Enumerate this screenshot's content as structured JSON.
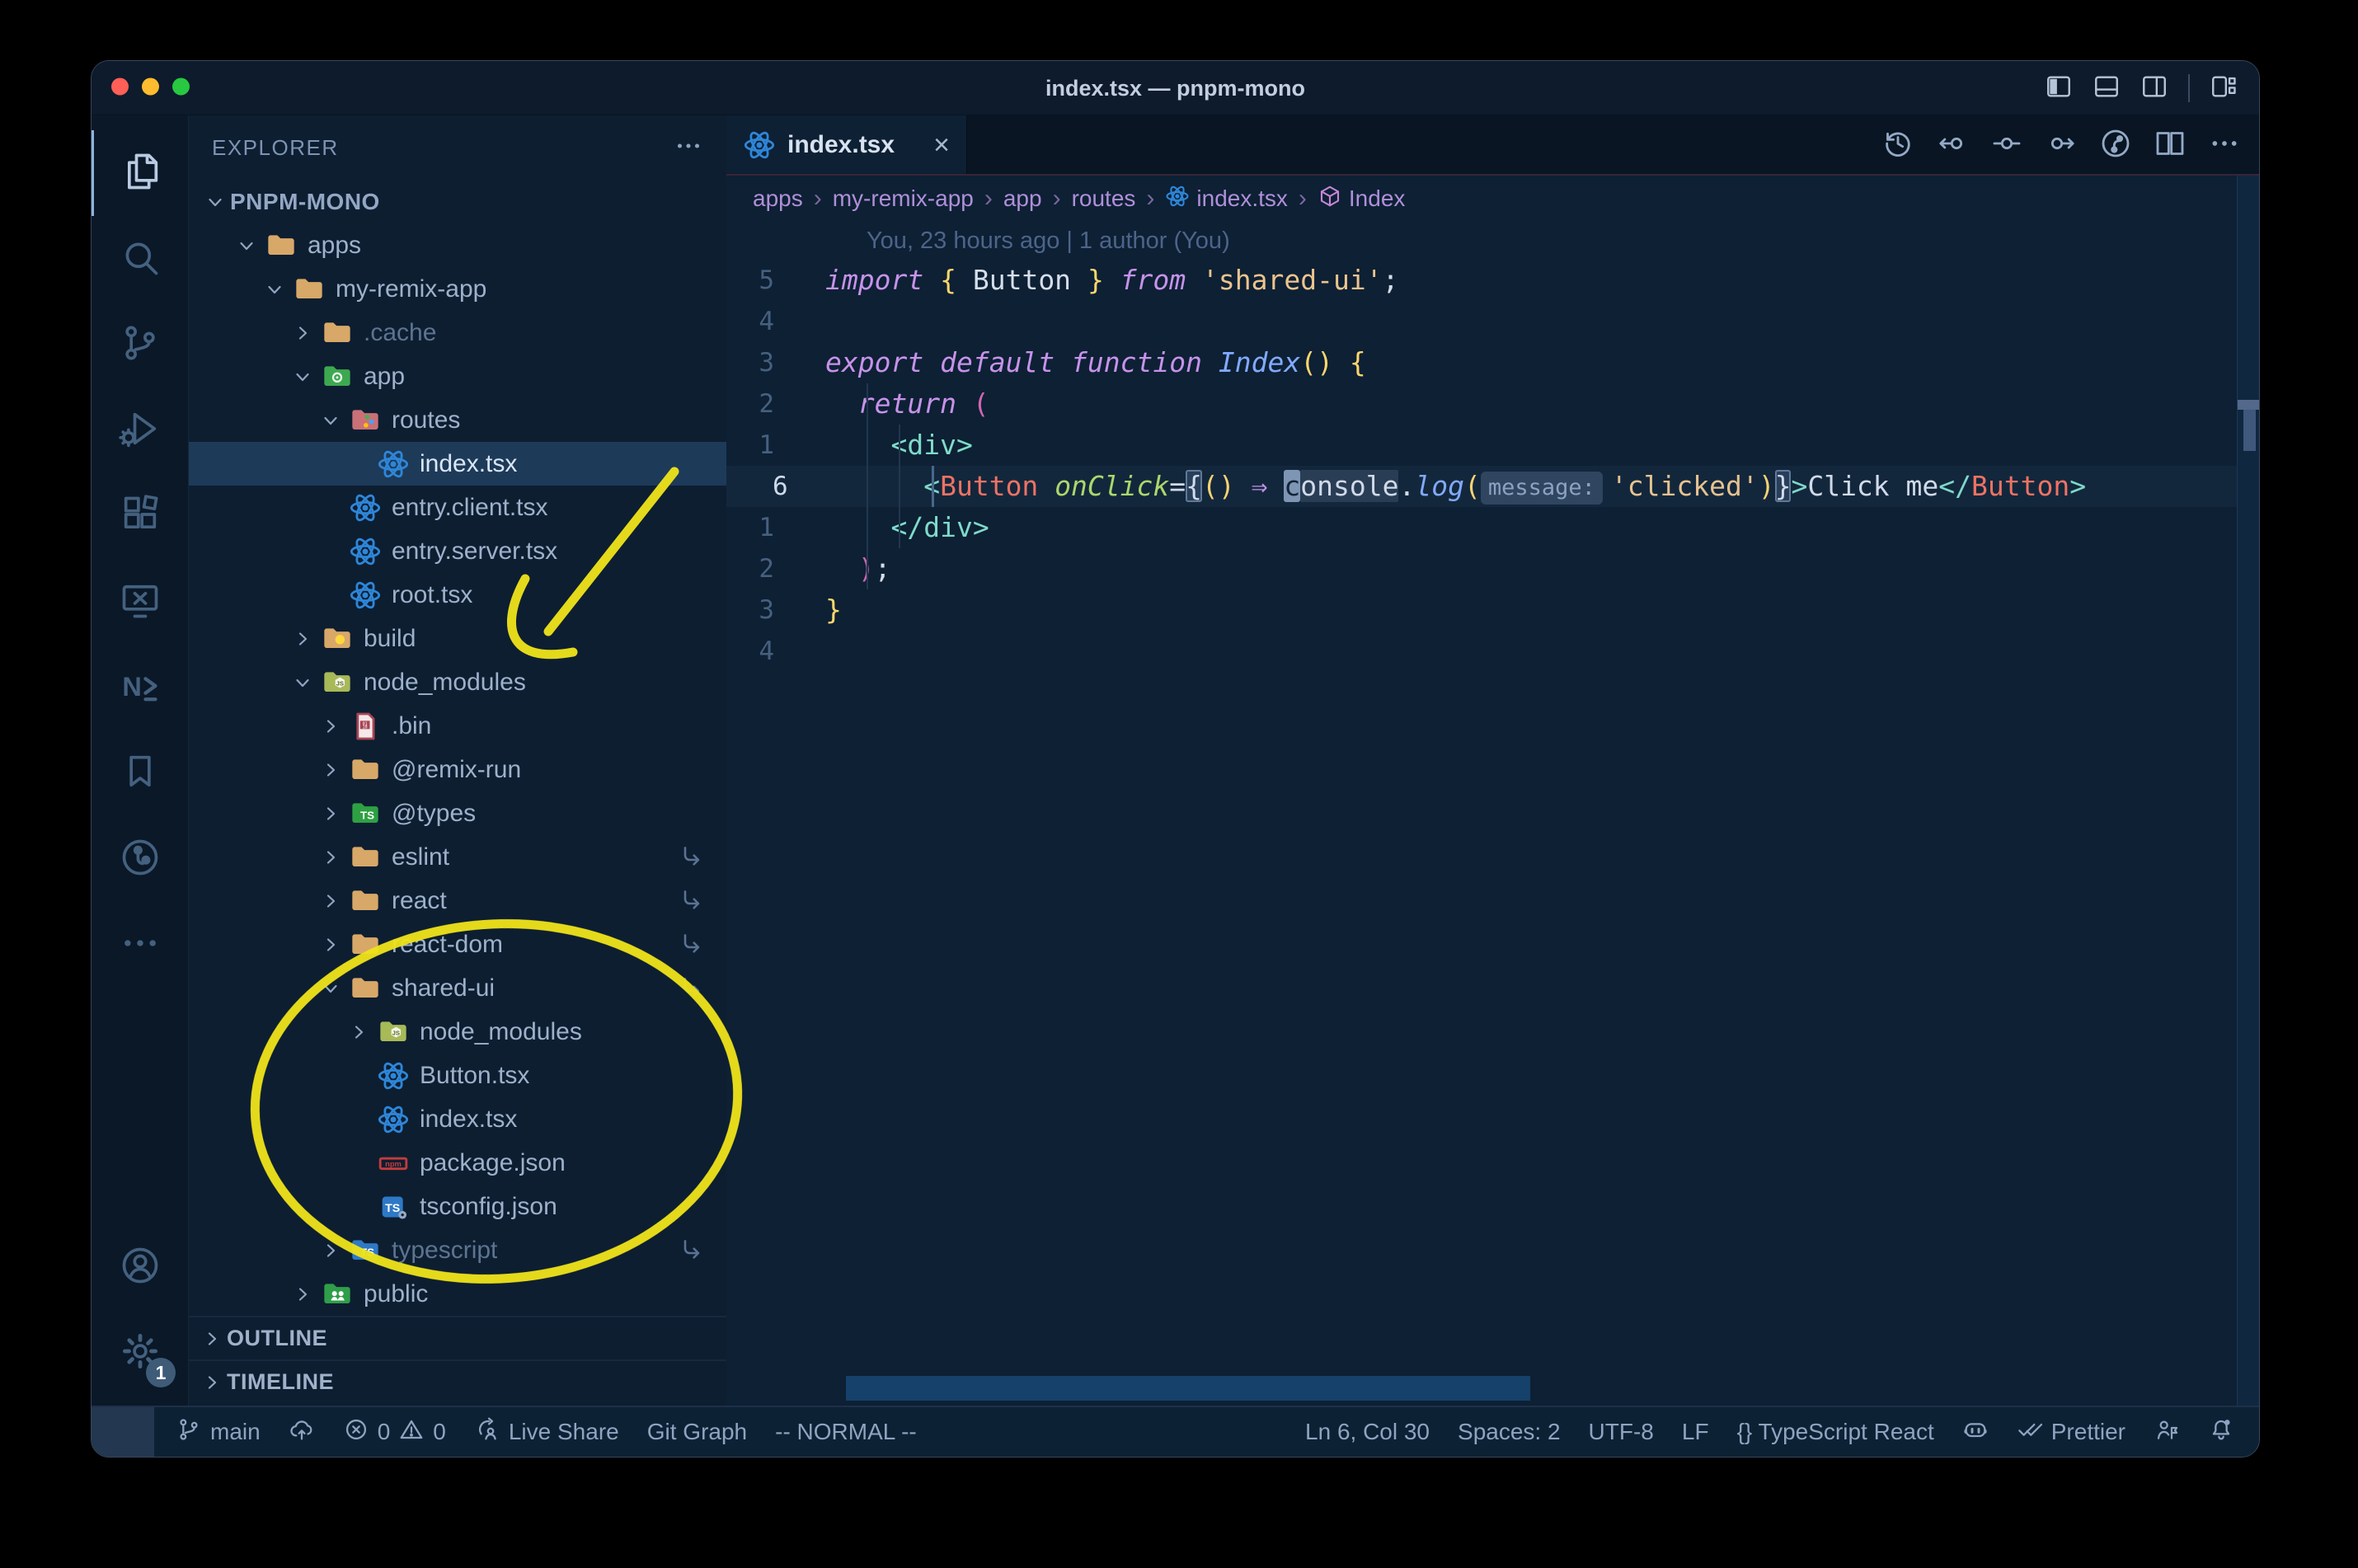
{
  "window": {
    "title": "index.tsx — pnpm-mono"
  },
  "titlebar": {
    "traffic_lights": [
      "close",
      "minimize",
      "zoom"
    ],
    "traffic_colors": [
      "#ff5f57",
      "#febc2e",
      "#28c840"
    ],
    "controls": [
      {
        "name": "toggle-primary-sidebar",
        "icon": "layout-left"
      },
      {
        "name": "toggle-panel",
        "icon": "layout-bottom"
      },
      {
        "name": "toggle-secondary-sidebar",
        "icon": "layout-right"
      },
      {
        "name": "separator",
        "icon": "separator"
      },
      {
        "name": "customize-layout",
        "icon": "layout-custom"
      }
    ]
  },
  "activity_bar": {
    "top": [
      {
        "name": "explorer",
        "icon": "files",
        "active": true
      },
      {
        "name": "search",
        "icon": "search"
      },
      {
        "name": "source-control",
        "icon": "scm"
      },
      {
        "name": "run-and-debug",
        "icon": "debug"
      },
      {
        "name": "extensions",
        "icon": "extensions"
      },
      {
        "name": "remote-explorer",
        "icon": "remote"
      },
      {
        "name": "nx-console",
        "icon": "nx"
      },
      {
        "name": "bookmarks",
        "icon": "bookmark"
      },
      {
        "name": "gitlens",
        "icon": "gitlens"
      },
      {
        "name": "additional-views",
        "icon": "ellipsis"
      }
    ],
    "bottom": [
      {
        "name": "accounts",
        "icon": "account"
      },
      {
        "name": "settings",
        "icon": "gear",
        "badge": "1"
      }
    ]
  },
  "sidebar": {
    "title": "EXPLORER",
    "root_label": "PNPM-MONO",
    "tree": [
      {
        "label": "apps",
        "icon": "folder-tan",
        "level": 1,
        "expanded": true
      },
      {
        "label": "my-remix-app",
        "icon": "folder-tan",
        "level": 2,
        "expanded": true
      },
      {
        "label": ".cache",
        "icon": "folder-tan",
        "level": 3,
        "expanded": false,
        "dimmed": true
      },
      {
        "label": "app",
        "icon": "folder-app",
        "level": 3,
        "expanded": true
      },
      {
        "label": "routes",
        "icon": "folder-routes",
        "level": 4,
        "expanded": true
      },
      {
        "label": "index.tsx",
        "icon": "react",
        "level": 5,
        "selected": true
      },
      {
        "label": "entry.client.tsx",
        "icon": "react",
        "level": 4
      },
      {
        "label": "entry.server.tsx",
        "icon": "react",
        "level": 4
      },
      {
        "label": "root.tsx",
        "icon": "react",
        "level": 4
      },
      {
        "label": "build",
        "icon": "folder-build",
        "level": 3,
        "expanded": false
      },
      {
        "label": "node_modules",
        "icon": "folder-nm",
        "level": 3,
        "expanded": true
      },
      {
        "label": ".bin",
        "icon": "file-bin",
        "level": 4,
        "expanded": false
      },
      {
        "label": "@remix-run",
        "icon": "folder-tan",
        "level": 4,
        "expanded": false
      },
      {
        "label": "@types",
        "icon": "folder-types",
        "level": 4,
        "expanded": false
      },
      {
        "label": "eslint",
        "icon": "folder-tan",
        "level": 4,
        "expanded": false,
        "symlink": true
      },
      {
        "label": "react",
        "icon": "folder-tan",
        "level": 4,
        "expanded": false,
        "symlink": true
      },
      {
        "label": "react-dom",
        "icon": "folder-tan",
        "level": 4,
        "expanded": false,
        "symlink": true
      },
      {
        "label": "shared-ui",
        "icon": "folder-tan",
        "level": 4,
        "expanded": true,
        "symlink": true
      },
      {
        "label": "node_modules",
        "icon": "folder-nm",
        "level": 5,
        "expanded": false
      },
      {
        "label": "Button.tsx",
        "icon": "react",
        "level": 5
      },
      {
        "label": "index.tsx",
        "icon": "react",
        "level": 5
      },
      {
        "label": "package.json",
        "icon": "file-npm",
        "level": 5
      },
      {
        "label": "tsconfig.json",
        "icon": "file-ts",
        "level": 5
      },
      {
        "label": "typescript",
        "icon": "folder-ts",
        "level": 4,
        "expanded": false,
        "dimmed": true,
        "symlink": true
      },
      {
        "label": "public",
        "icon": "folder-public",
        "level": 3,
        "expanded": false
      }
    ],
    "sections": [
      {
        "label": "OUTLINE"
      },
      {
        "label": "TIMELINE"
      }
    ]
  },
  "editor": {
    "tab": {
      "icon": "react",
      "label": "index.tsx",
      "close": "×"
    },
    "actions": [
      {
        "name": "timeline-history",
        "icon": "history"
      },
      {
        "name": "previous-change",
        "icon": "prev-change"
      },
      {
        "name": "current-change",
        "icon": "dot-change"
      },
      {
        "name": "next-change",
        "icon": "next-change"
      },
      {
        "name": "file-history-graph",
        "icon": "graph"
      },
      {
        "name": "split-editor",
        "icon": "split"
      },
      {
        "name": "more-actions",
        "icon": "ellipsis"
      }
    ],
    "breadcrumbs": [
      {
        "label": "apps"
      },
      {
        "label": "my-remix-app"
      },
      {
        "label": "app"
      },
      {
        "label": "routes"
      },
      {
        "label": "index.tsx",
        "icon": "react"
      },
      {
        "label": "Index",
        "icon": "symbol-module"
      }
    ],
    "blame": "You, 23 hours ago | 1 author (You)",
    "lines": [
      {
        "num": "5",
        "segs": [
          [
            "import",
            "kw"
          ],
          [
            " ",
            "txt"
          ],
          [
            "{",
            "gold"
          ],
          [
            " ",
            "txt"
          ],
          [
            "Button",
            "txt"
          ],
          [
            " ",
            "txt"
          ],
          [
            "}",
            "gold"
          ],
          [
            " ",
            "txt"
          ],
          [
            "from",
            "kw"
          ],
          [
            " ",
            "txt"
          ],
          [
            "'shared-ui'",
            "str"
          ],
          [
            ";",
            "txt"
          ]
        ]
      },
      {
        "num": "4",
        "segs": []
      },
      {
        "num": "3",
        "segs": [
          [
            "export",
            "kw"
          ],
          [
            " ",
            "txt"
          ],
          [
            "default",
            "kw"
          ],
          [
            " ",
            "txt"
          ],
          [
            "function",
            "kw"
          ],
          [
            " ",
            "txt"
          ],
          [
            "Index",
            "fn"
          ],
          [
            "()",
            "gold"
          ],
          [
            " ",
            "txt"
          ],
          [
            "{",
            "gold"
          ]
        ]
      },
      {
        "num": "2",
        "segs": [
          [
            "  ",
            "txt"
          ],
          [
            "return",
            "kw"
          ],
          [
            " ",
            "txt"
          ],
          [
            "(",
            "pink"
          ]
        ]
      },
      {
        "num": "1",
        "segs": [
          [
            "    ",
            "txt"
          ],
          [
            "<div>",
            "teal"
          ]
        ]
      },
      {
        "num": "6",
        "current": true,
        "segs": [
          [
            "      ",
            "txt"
          ],
          [
            "<",
            "teal"
          ],
          [
            "Button",
            "tag"
          ],
          [
            " ",
            "txt"
          ],
          [
            "onClick",
            "attr"
          ],
          [
            "=",
            "txt"
          ],
          [
            "{",
            "bracket"
          ],
          [
            "()",
            "gold"
          ],
          [
            " ",
            "txt"
          ],
          [
            "⇒",
            "kw2"
          ],
          [
            " ",
            "txt"
          ],
          [
            "c",
            "cursor"
          ],
          [
            "onsole",
            "wordhl"
          ],
          [
            ".",
            "txt"
          ],
          [
            "log",
            "fn"
          ],
          [
            "(",
            "gold"
          ],
          [
            "message:",
            "inlay"
          ],
          [
            "'clicked'",
            "str"
          ],
          [
            ")",
            "gold"
          ],
          [
            "}",
            "bracket"
          ],
          [
            ">",
            "teal"
          ],
          [
            "Click me",
            "txt"
          ],
          [
            "</",
            "teal"
          ],
          [
            "Button",
            "tag"
          ],
          [
            ">",
            "teal"
          ]
        ]
      },
      {
        "num": "1",
        "segs": [
          [
            "    ",
            "txt"
          ],
          [
            "</div>",
            "teal"
          ]
        ]
      },
      {
        "num": "2",
        "segs": [
          [
            "  ",
            "txt"
          ],
          [
            ")",
            "pink"
          ],
          [
            ";",
            "txt"
          ]
        ]
      },
      {
        "num": "3",
        "segs": [
          [
            "}",
            "gold"
          ]
        ]
      },
      {
        "num": "4",
        "segs": []
      }
    ]
  },
  "status_bar": {
    "left": [
      {
        "name": "remote-indicator",
        "icon": "remote-ind",
        "label": ""
      },
      {
        "name": "git-branch",
        "icon": "branch",
        "label": "main"
      },
      {
        "name": "sync-changes",
        "icon": "cloud-upload",
        "label": ""
      },
      {
        "name": "problems",
        "icon": "error",
        "label": "0",
        "icon2": "warning",
        "label2": "0"
      },
      {
        "name": "live-share",
        "icon": "liveshare",
        "label": "Live Share"
      },
      {
        "name": "git-graph",
        "icon": "",
        "label": "Git Graph"
      },
      {
        "name": "vim-mode",
        "icon": "",
        "label": "-- NORMAL --"
      }
    ],
    "right": [
      {
        "name": "cursor-position",
        "icon": "",
        "label": "Ln 6, Col 30"
      },
      {
        "name": "indentation",
        "icon": "",
        "label": "Spaces: 2"
      },
      {
        "name": "encoding",
        "icon": "",
        "label": "UTF-8"
      },
      {
        "name": "eol",
        "icon": "",
        "label": "LF"
      },
      {
        "name": "language-mode",
        "icon": "",
        "label": "{} TypeScript React"
      },
      {
        "name": "copilot",
        "icon": "copilot",
        "label": ""
      },
      {
        "name": "formatter",
        "icon": "double-check",
        "label": "Prettier"
      },
      {
        "name": "feedback",
        "icon": "person-flag",
        "label": ""
      },
      {
        "name": "notifications",
        "icon": "bell-dot",
        "label": ""
      }
    ]
  },
  "annotations": {
    "color": "#efe31b",
    "items": [
      {
        "type": "arrow",
        "target": "node_modules folder in explorer"
      },
      {
        "type": "ellipse",
        "target": "shared-ui package contents in explorer"
      }
    ]
  }
}
